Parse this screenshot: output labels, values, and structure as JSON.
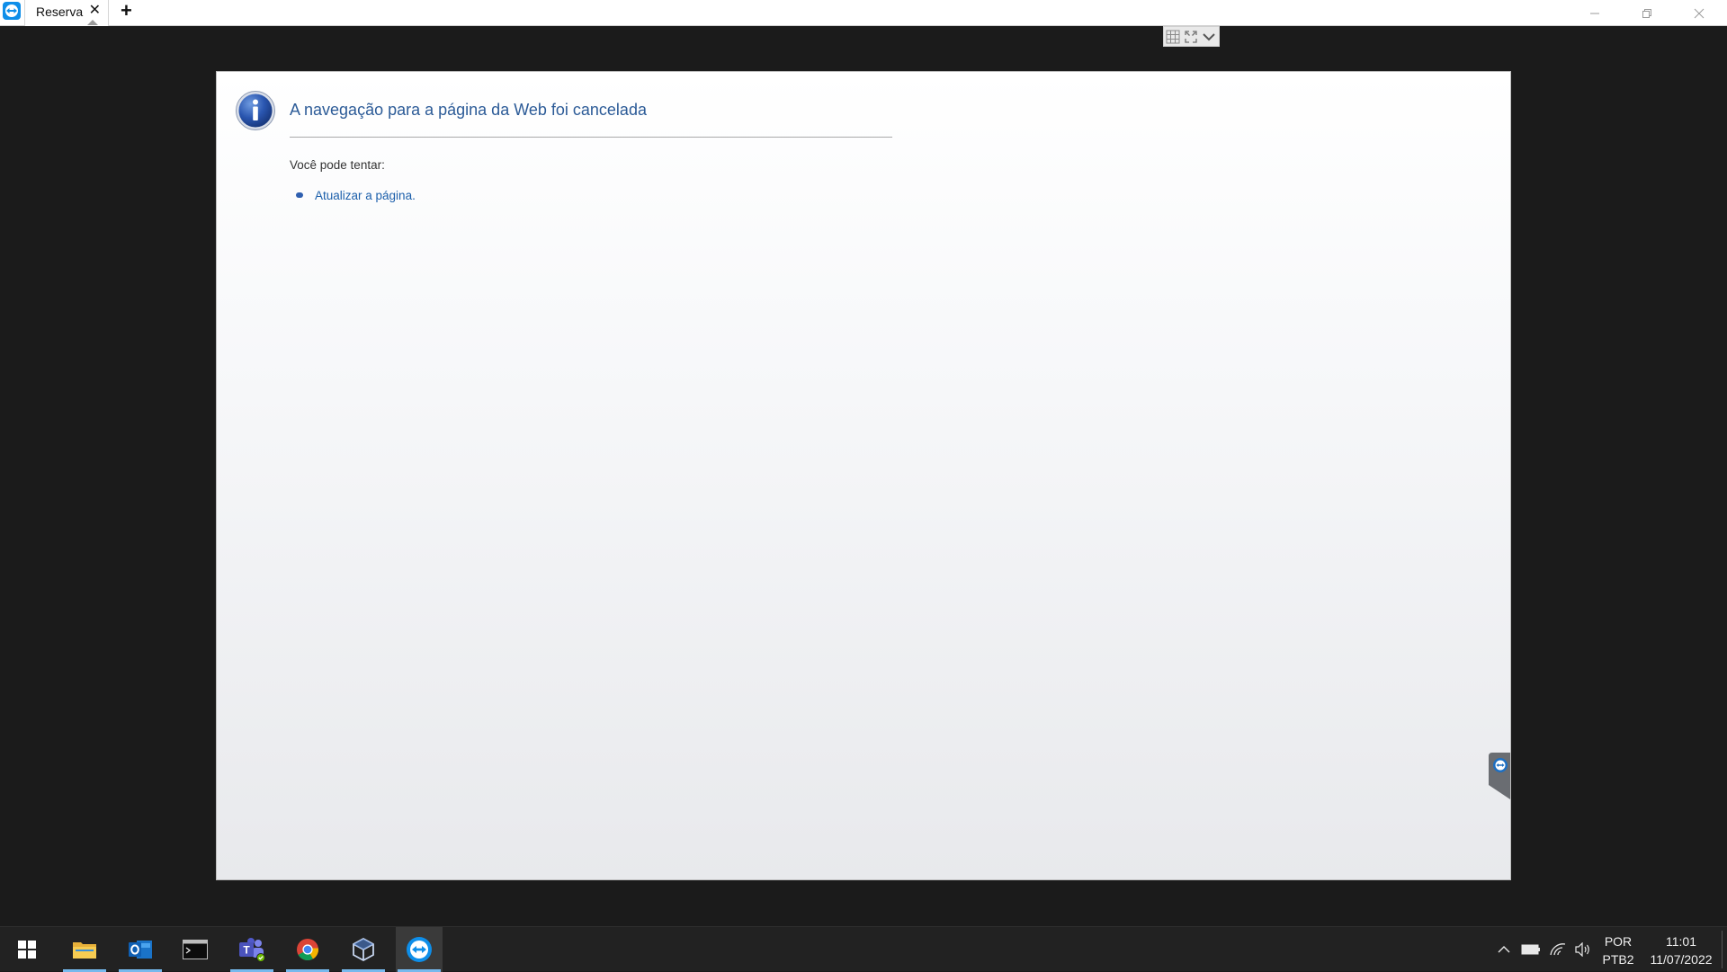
{
  "topbar": {
    "tab_label": "Reserva",
    "tab_close_glyph": "✕",
    "new_tab_glyph": "+",
    "controls": {
      "minimize": "—",
      "maximize": "❐",
      "close": "✕"
    }
  },
  "remote_toolbar": {
    "icons": [
      "grid-icon",
      "fullscreen-icon",
      "chevron-down-icon"
    ]
  },
  "page": {
    "title": "A navegação para a página da Web foi cancelada",
    "try_label": "Você pode tentar:",
    "refresh_link": "Atualizar a página."
  },
  "taskbar": {
    "apps": [
      "windows-start",
      "file-explorer",
      "outlook",
      "terminal",
      "teams",
      "chrome",
      "virtualbox",
      "teamviewer"
    ],
    "language": {
      "line1": "POR",
      "line2": "PTB2"
    },
    "clock": {
      "time": "11:01",
      "date": "11/07/2022"
    }
  },
  "colors": {
    "accent": "#2c5b97",
    "link": "#1c5fab",
    "taskbar": "#222222",
    "background": "#1b1b1b",
    "teamviewer_blue": "#0e8ee9"
  }
}
